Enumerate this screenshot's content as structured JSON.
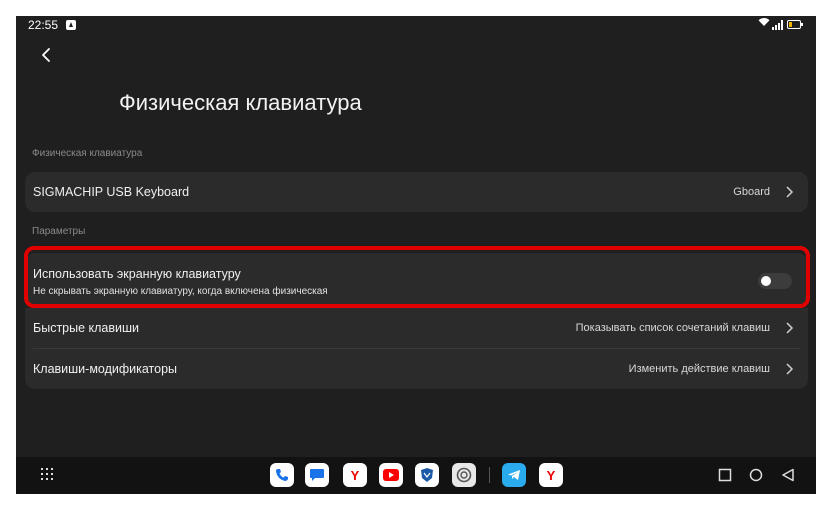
{
  "status": {
    "time": "22:55"
  },
  "header": {
    "title": "Физическая клавиатура"
  },
  "sections": {
    "keyboard_label": "Физическая клавиатура",
    "params_label": "Параметры"
  },
  "keyboard_row": {
    "label": "SIGMACHIP USB Keyboard",
    "value": "Gboard"
  },
  "onscreen_row": {
    "label": "Использовать экранную клавиатуру",
    "sub": "Не скрывать экранную клавиатуру, когда включена физическая",
    "toggle_on": false
  },
  "shortcuts_row": {
    "label": "Быстрые клавиши",
    "value": "Показывать список сочетаний клавиш"
  },
  "modifiers_row": {
    "label": "Клавиши-модификаторы",
    "value": "Изменить действие клавиш"
  },
  "dock": {
    "apps": [
      "phone-app",
      "messages-app",
      "yandex-browser-app",
      "youtube-app",
      "gosuslugi-app",
      "settings-app",
      "telegram-app",
      "yandex-app"
    ],
    "yandex_glyph": "Y"
  },
  "colors": {
    "highlight": "#e00000",
    "background": "#1f1f1f",
    "card": "#2b2b2b"
  }
}
